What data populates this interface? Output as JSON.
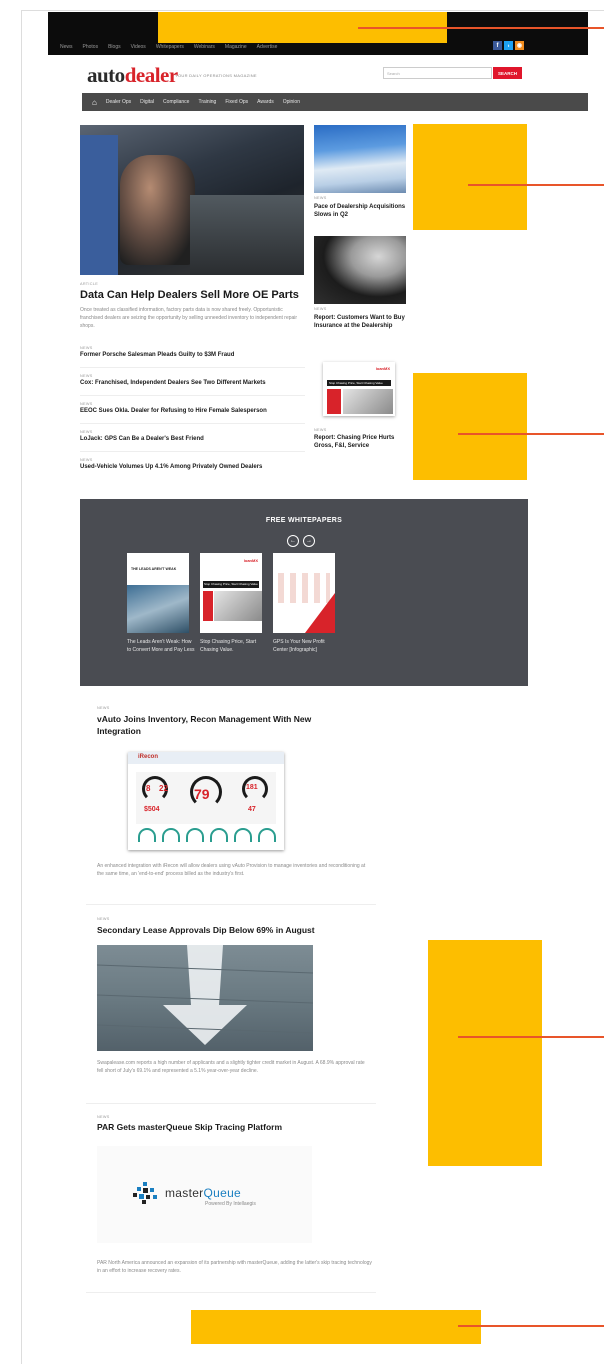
{
  "top_nav": [
    "News",
    "Photos",
    "Blogs",
    "Videos",
    "Whitepapers",
    "Webinars",
    "Magazine",
    "Advertise"
  ],
  "social": [
    "f",
    "t",
    "rss"
  ],
  "logo": {
    "part1": "auto",
    "part2": "dealer",
    "tagline": "YOUR DAILY OPERATIONS MAGAZINE"
  },
  "search": {
    "placeholder": "Search",
    "button": "SEARCH"
  },
  "main_nav": [
    "Dealer Ops",
    "Digital",
    "Compliance",
    "Training",
    "Fixed Ops",
    "Awards",
    "Opinion"
  ],
  "hero": {
    "label": "ARTICLE",
    "title": "Data Can Help Dealers Sell More OE Parts",
    "desc": "Once treated as classified information, factory parts data is now shared freely. Opportunistic franchised dealers are seizing the opportunity by selling unneeded inventory to independent repair shops."
  },
  "news_list": [
    {
      "label": "NEWS",
      "title": "Former Porsche Salesman Pleads Guilty to $3M Fraud"
    },
    {
      "label": "NEWS",
      "title": "Cox: Franchised, Independent Dealers See Two Different Markets"
    },
    {
      "label": "NEWS",
      "title": "EEOC Sues Okla. Dealer for Refusing to Hire Female Salesperson"
    },
    {
      "label": "NEWS",
      "title": "LoJack: GPS Can Be a Dealer's Best Friend"
    },
    {
      "label": "NEWS",
      "title": "Used-Vehicle Volumes Up 4.1% Among Privately Owned Dealers"
    }
  ],
  "right_col": [
    {
      "label": "NEWS",
      "title": "Pace of Dealership Acquisitions Slows in Q2"
    },
    {
      "label": "NEWS",
      "title": "Report: Customers Want to Buy Insurance at the Dealership"
    },
    {
      "label": "NEWS",
      "title": "Report: Chasing Price Hurts Gross, F&I, Service"
    }
  ],
  "whitepapers": {
    "title": "FREE WHITEPAPERS",
    "items": [
      {
        "caption": "The Leads Aren't Weak: How to Convert More and Pay Less",
        "cover_title": "THE LEADS AREN'T WEAK"
      },
      {
        "caption": "Stop Chasing Price, Start Chasing Value.",
        "cover_title": "Stop Chasing Price, Start Chasing Value"
      },
      {
        "caption": "GPS Is Your New Profit Center [Infographic]",
        "cover_title": ""
      }
    ]
  },
  "articles": [
    {
      "label": "NEWS",
      "title": "vAuto Joins Inventory, Recon Management With New Integration",
      "desc": "An enhanced integration with iRecon will allow dealers using vAuto Provision to manage inventories and reconditioning at the same time, an 'end-to-end' process billed as the industry's first."
    },
    {
      "label": "NEWS",
      "title": "Secondary Lease Approvals Dip Below 69% in August",
      "desc": "Swapalease.com reports a high number of applicants and a slightly tighter credit market in August. A 68.9% approval rate fell short of July's 69.1% and represented a 5.1% year-over-year decline."
    },
    {
      "label": "NEWS",
      "title": "PAR Gets masterQueue Skip Tracing Platform",
      "desc": "PAR North America announced an expansion of its partnership with masterQueue, adding the latter's skip tracing technology in an effort to increase recovery rates."
    }
  ],
  "dashboard": {
    "brand": "iRecon",
    "metrics": [
      "8",
      "22",
      "79",
      "181",
      "$504",
      "47"
    ]
  },
  "masterqueue": {
    "name_a": "master",
    "name_b": "Queue",
    "sub": "Powered By Intellaegis"
  },
  "colors": {
    "accent": "#e0162b",
    "nav_bg": "#4a4a4a",
    "ad": "#fdbe00",
    "callout": "#e8552a",
    "wp_bg": "#4a4c52"
  }
}
